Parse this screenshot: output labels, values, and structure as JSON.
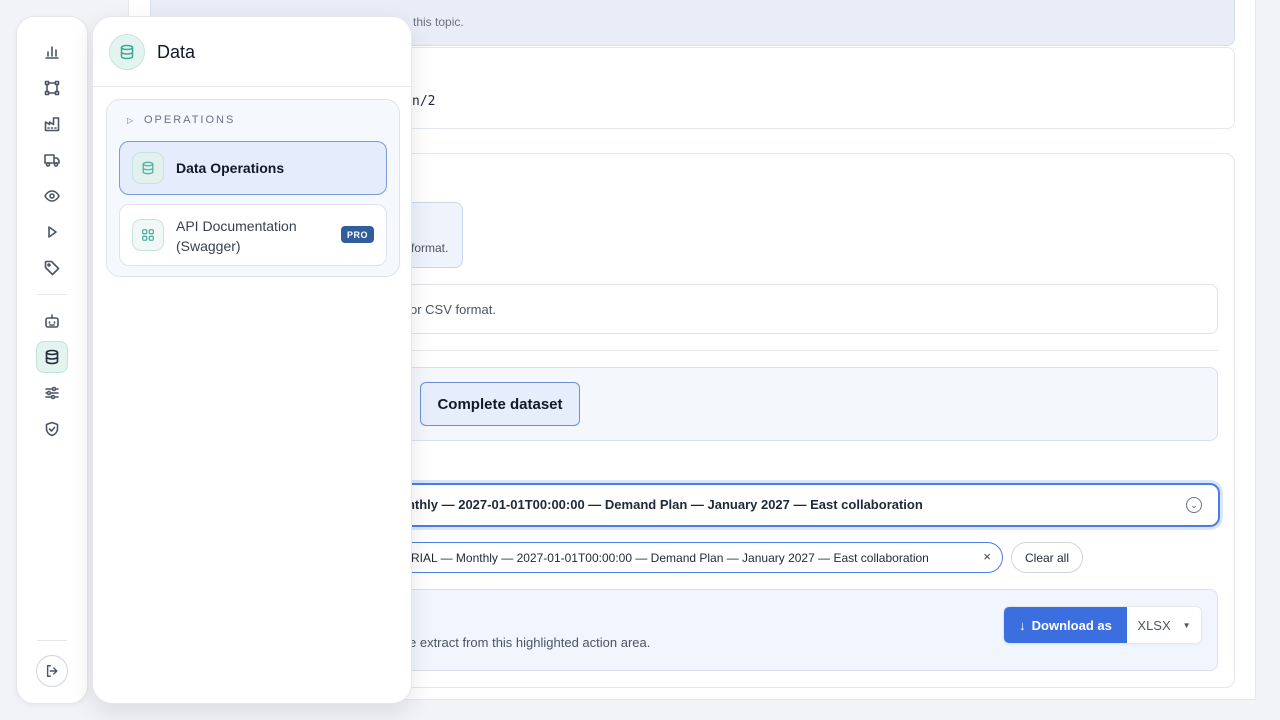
{
  "banner": {
    "subtitle": "this topic."
  },
  "card1": {
    "value": "n/2"
  },
  "export": {
    "format_hint": "format.",
    "description": "or CSV format.",
    "scope_label": "Complete dataset",
    "select_value": "onthly — 2027-01-01T00:00:00 — Demand Plan — January 2027 — East collaboration",
    "tag_value": "RIAL — Monthly — 2027-01-01T00:00:00 — Demand Plan — January 2027 — East collaboration",
    "tag_remove": "×",
    "clear_all": "Clear all",
    "action_text": "e extract from this highlighted action area.",
    "download_label": "Download as",
    "download_arrow": "↓",
    "format_value": "XLSX",
    "format_caret": "▼"
  },
  "rail": {
    "icons": [
      "bar-chart-icon",
      "workflow-icon",
      "factory-icon",
      "truck-icon",
      "eye-icon",
      "play-icon",
      "tag-icon",
      "robot-icon",
      "database-icon",
      "sliders-icon",
      "shield-check-icon",
      "logout-icon"
    ],
    "active": "database-icon"
  },
  "panel": {
    "title": "Data",
    "group_label": "OPERATIONS",
    "group_toggle": "▷",
    "items": [
      {
        "label": "Data Operations",
        "active": true
      },
      {
        "label": "API Documentation (Swagger)",
        "badge": "PRO",
        "active": false
      }
    ]
  },
  "colors": {
    "accent": "#3b6fe0",
    "teal": "#3aa897",
    "badge": "#2f5d9e"
  }
}
